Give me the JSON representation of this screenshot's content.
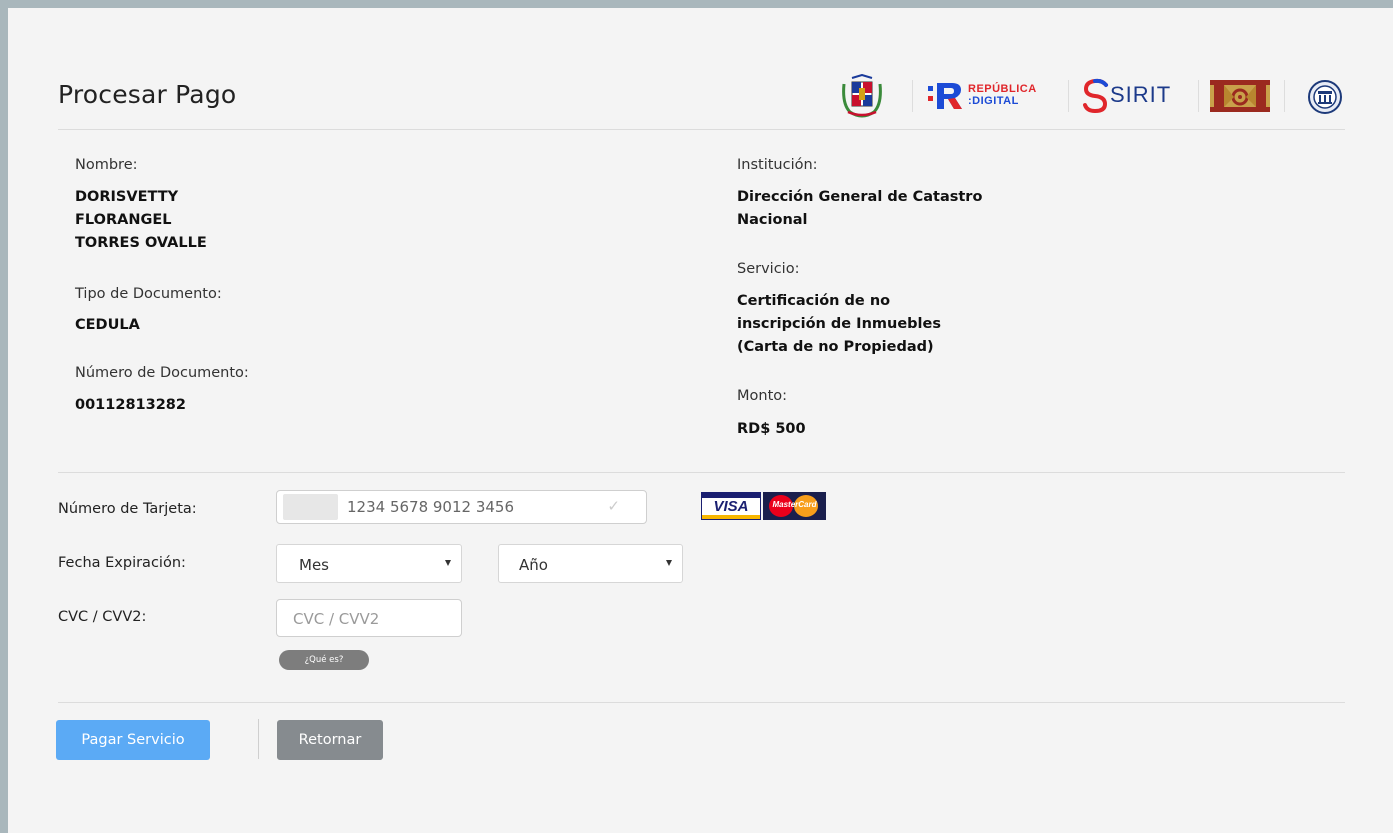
{
  "header": {
    "title": "Procesar Pago",
    "logos": {
      "republica_digital_top": "REPÚBLICA",
      "republica_digital_bottom": ":DIGITAL",
      "sirit": "SIRIT"
    }
  },
  "details": {
    "nombre_label": "Nombre:",
    "nombre_lines": [
      "DORISVETTY",
      "FLORANGEL",
      "TORRES OVALLE"
    ],
    "tipo_doc_label": "Tipo de Documento:",
    "tipo_doc_value": "CEDULA",
    "num_doc_label": "Número de Documento:",
    "num_doc_value": "00112813282",
    "institucion_label": "Institución:",
    "institucion_lines": [
      "Dirección General de Catastro",
      "Nacional"
    ],
    "servicio_label": "Servicio:",
    "servicio_lines": [
      "Certificación de no",
      "inscripción de Inmuebles",
      "(Carta de no Propiedad)"
    ],
    "monto_label": "Monto:",
    "monto_value": "RD$ 500"
  },
  "payment": {
    "card_label": "Número de Tarjeta:",
    "card_placeholder": "1234 5678 9012 3456",
    "visa_text": "VISA",
    "mastercard_text": "MasterCard",
    "expiry_label": "Fecha Expiración:",
    "month_selected": "Mes",
    "year_selected": "Año",
    "cvc_label": "CVC / CVV2:",
    "cvc_placeholder": "CVC / CVV2",
    "what_is_label": "¿Qué es?"
  },
  "actions": {
    "pay_label": "Pagar Servicio",
    "back_label": "Retornar"
  },
  "colors": {
    "pay_button": "#5baaf5",
    "back_button": "#868b8f",
    "tooltip_pill": "#7d7d7d"
  }
}
